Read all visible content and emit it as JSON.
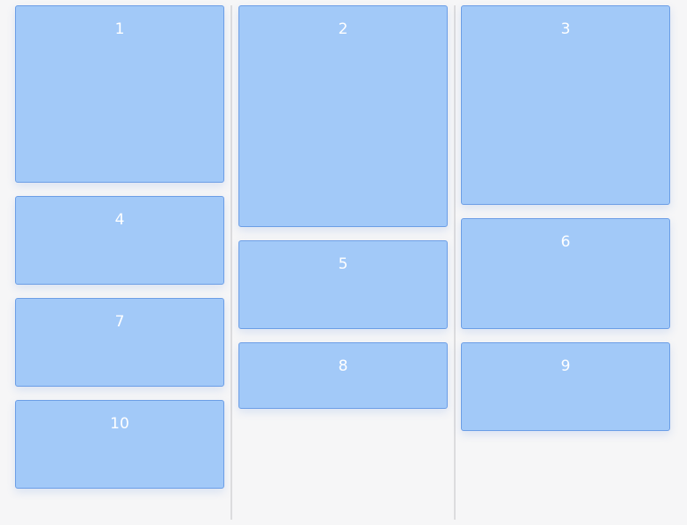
{
  "board": {
    "columns": [
      {
        "cards": [
          {
            "label": "1"
          },
          {
            "label": "4"
          },
          {
            "label": "7"
          },
          {
            "label": "10"
          }
        ]
      },
      {
        "cards": [
          {
            "label": "2"
          },
          {
            "label": "5"
          },
          {
            "label": "8"
          }
        ]
      },
      {
        "cards": [
          {
            "label": "3"
          },
          {
            "label": "6"
          },
          {
            "label": "9"
          }
        ]
      }
    ]
  },
  "colors": {
    "card_fill": "#a2c9f8",
    "card_border": "#6c9ee6",
    "card_text": "#ffffff",
    "background": "#f6f6f7",
    "divider": "#dcdcde"
  }
}
